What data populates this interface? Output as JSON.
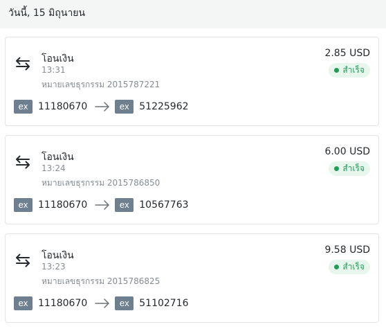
{
  "date_header": "วันนี้, 15 มิถุนายน",
  "colors": {
    "badge": "#6e7f8f",
    "success": "#1f9d55",
    "success_bg": "#e8f7ee",
    "muted": "#858c93"
  },
  "transactions": [
    {
      "title": "โอนเงิน",
      "time": "13:31",
      "txid": "หมายเลขธุรกรรม 2015787221",
      "amount": "2.85 USD",
      "status": "สำเร็จ",
      "from_badge": "ex",
      "from_account": "11180670",
      "to_badge": "ex",
      "to_account": "51225962",
      "icons": {
        "type": "swap-arrows-icon",
        "route": "arrow-right-icon"
      }
    },
    {
      "title": "โอนเงิน",
      "time": "13:24",
      "txid": "หมายเลขธุรกรรม 2015786850",
      "amount": "6.00 USD",
      "status": "สำเร็จ",
      "from_badge": "ex",
      "from_account": "11180670",
      "to_badge": "ex",
      "to_account": "10567763",
      "icons": {
        "type": "swap-arrows-icon",
        "route": "arrow-right-icon"
      }
    },
    {
      "title": "โอนเงิน",
      "time": "13:23",
      "txid": "หมายเลขธุรกรรม 2015786825",
      "amount": "9.58 USD",
      "status": "สำเร็จ",
      "from_badge": "ex",
      "from_account": "11180670",
      "to_badge": "ex",
      "to_account": "51102716",
      "icons": {
        "type": "swap-arrows-icon",
        "route": "arrow-right-icon"
      }
    }
  ]
}
